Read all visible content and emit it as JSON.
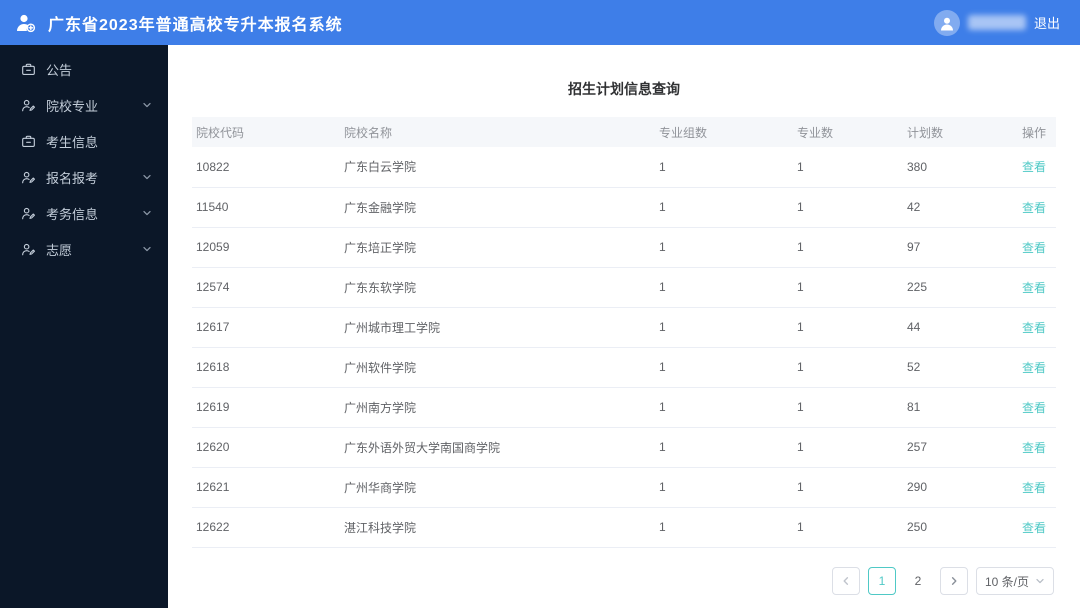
{
  "colors": {
    "header_blue": "#3e7ee8",
    "sidebar_dark": "#0b1728",
    "link_teal": "#4fc9c6"
  },
  "header": {
    "system_title": "广东省2023年普通高校专升本报名系统",
    "logout_label": "退出"
  },
  "sidebar": {
    "items": [
      {
        "label": "公告",
        "icon": "briefcase-icon",
        "has_submenu": false
      },
      {
        "label": "院校专业",
        "icon": "user-edit-icon",
        "has_submenu": true
      },
      {
        "label": "考生信息",
        "icon": "briefcase-icon",
        "has_submenu": false
      },
      {
        "label": "报名报考",
        "icon": "user-edit-icon",
        "has_submenu": true
      },
      {
        "label": "考务信息",
        "icon": "user-edit-icon",
        "has_submenu": true
      },
      {
        "label": "志愿",
        "icon": "user-edit-icon",
        "has_submenu": true
      }
    ]
  },
  "main": {
    "page_title": "招生计划信息查询",
    "table": {
      "columns": [
        "院校代码",
        "院校名称",
        "专业组数",
        "专业数",
        "计划数",
        "操作"
      ],
      "action_label": "查看",
      "rows": [
        {
          "code": "10822",
          "name": "广东白云学院",
          "groups": "1",
          "majors": "1",
          "plan": "380"
        },
        {
          "code": "11540",
          "name": "广东金融学院",
          "groups": "1",
          "majors": "1",
          "plan": "42"
        },
        {
          "code": "12059",
          "name": "广东培正学院",
          "groups": "1",
          "majors": "1",
          "plan": "97"
        },
        {
          "code": "12574",
          "name": "广东东软学院",
          "groups": "1",
          "majors": "1",
          "plan": "225"
        },
        {
          "code": "12617",
          "name": "广州城市理工学院",
          "groups": "1",
          "majors": "1",
          "plan": "44"
        },
        {
          "code": "12618",
          "name": "广州软件学院",
          "groups": "1",
          "majors": "1",
          "plan": "52"
        },
        {
          "code": "12619",
          "name": "广州南方学院",
          "groups": "1",
          "majors": "1",
          "plan": "81"
        },
        {
          "code": "12620",
          "name": "广东外语外贸大学南国商学院",
          "groups": "1",
          "majors": "1",
          "plan": "257"
        },
        {
          "code": "12621",
          "name": "广州华商学院",
          "groups": "1",
          "majors": "1",
          "plan": "290"
        },
        {
          "code": "12622",
          "name": "湛江科技学院",
          "groups": "1",
          "majors": "1",
          "plan": "250"
        }
      ]
    },
    "pagination": {
      "page_1": "1",
      "page_2": "2",
      "active_page": "1",
      "page_size_label": "10 条/页"
    }
  }
}
